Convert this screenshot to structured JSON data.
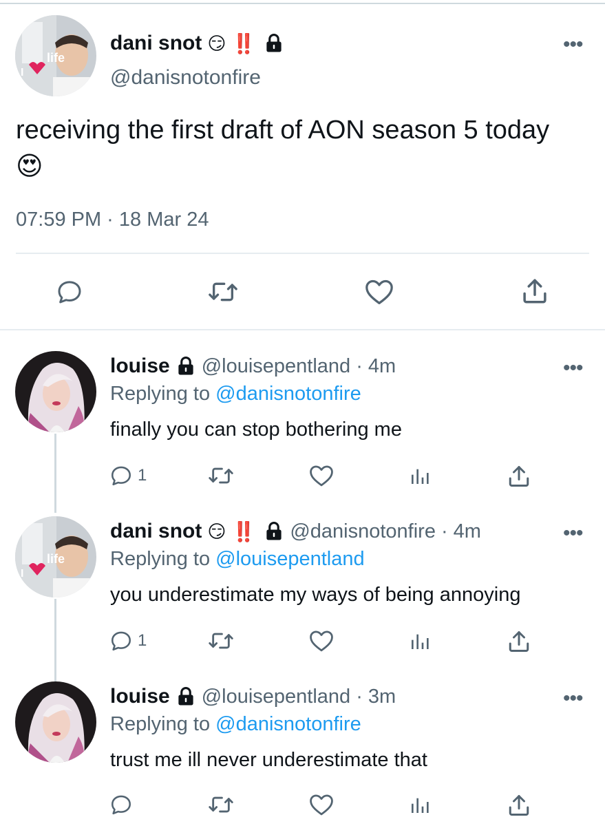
{
  "main": {
    "name": "dani snot",
    "name_emoji": "😏",
    "name_bangs": "‼️",
    "handle": "@danisnotonfire",
    "text": "receiving the first draft of AON season 5 today",
    "text_emoji": "😍",
    "timestamp": "07:59 PM · 18 Mar 24",
    "avatar_text": "life",
    "actions": [
      "reply-icon",
      "retweet-icon",
      "like-icon",
      "share-icon"
    ]
  },
  "replies": [
    {
      "name": "louise",
      "handle": "@louisepentland",
      "time": "· 4m",
      "replying_prefix": "Replying to",
      "replying_to": "@danisnotonfire",
      "text": "finally you can stop bothering me",
      "reply_count": "1"
    },
    {
      "name": "dani snot",
      "name_emoji": "😏",
      "name_bangs": "‼️",
      "handle": "@danisnotonfire",
      "time": "· 4m",
      "replying_prefix": "Replying to",
      "replying_to": "@louisepentland",
      "text": "you underestimate my ways of being annoying",
      "reply_count": "1",
      "avatar_text": "life"
    },
    {
      "name": "louise",
      "handle": "@louisepentland",
      "time": "· 3m",
      "replying_prefix": "Replying to",
      "replying_to": "@danisnotonfire",
      "text": "trust me ill never underestimate that",
      "reply_count": ""
    }
  ],
  "colors": {
    "link": "#1d9bf0",
    "secondary_text": "#536471",
    "heart": "#e0245e"
  }
}
